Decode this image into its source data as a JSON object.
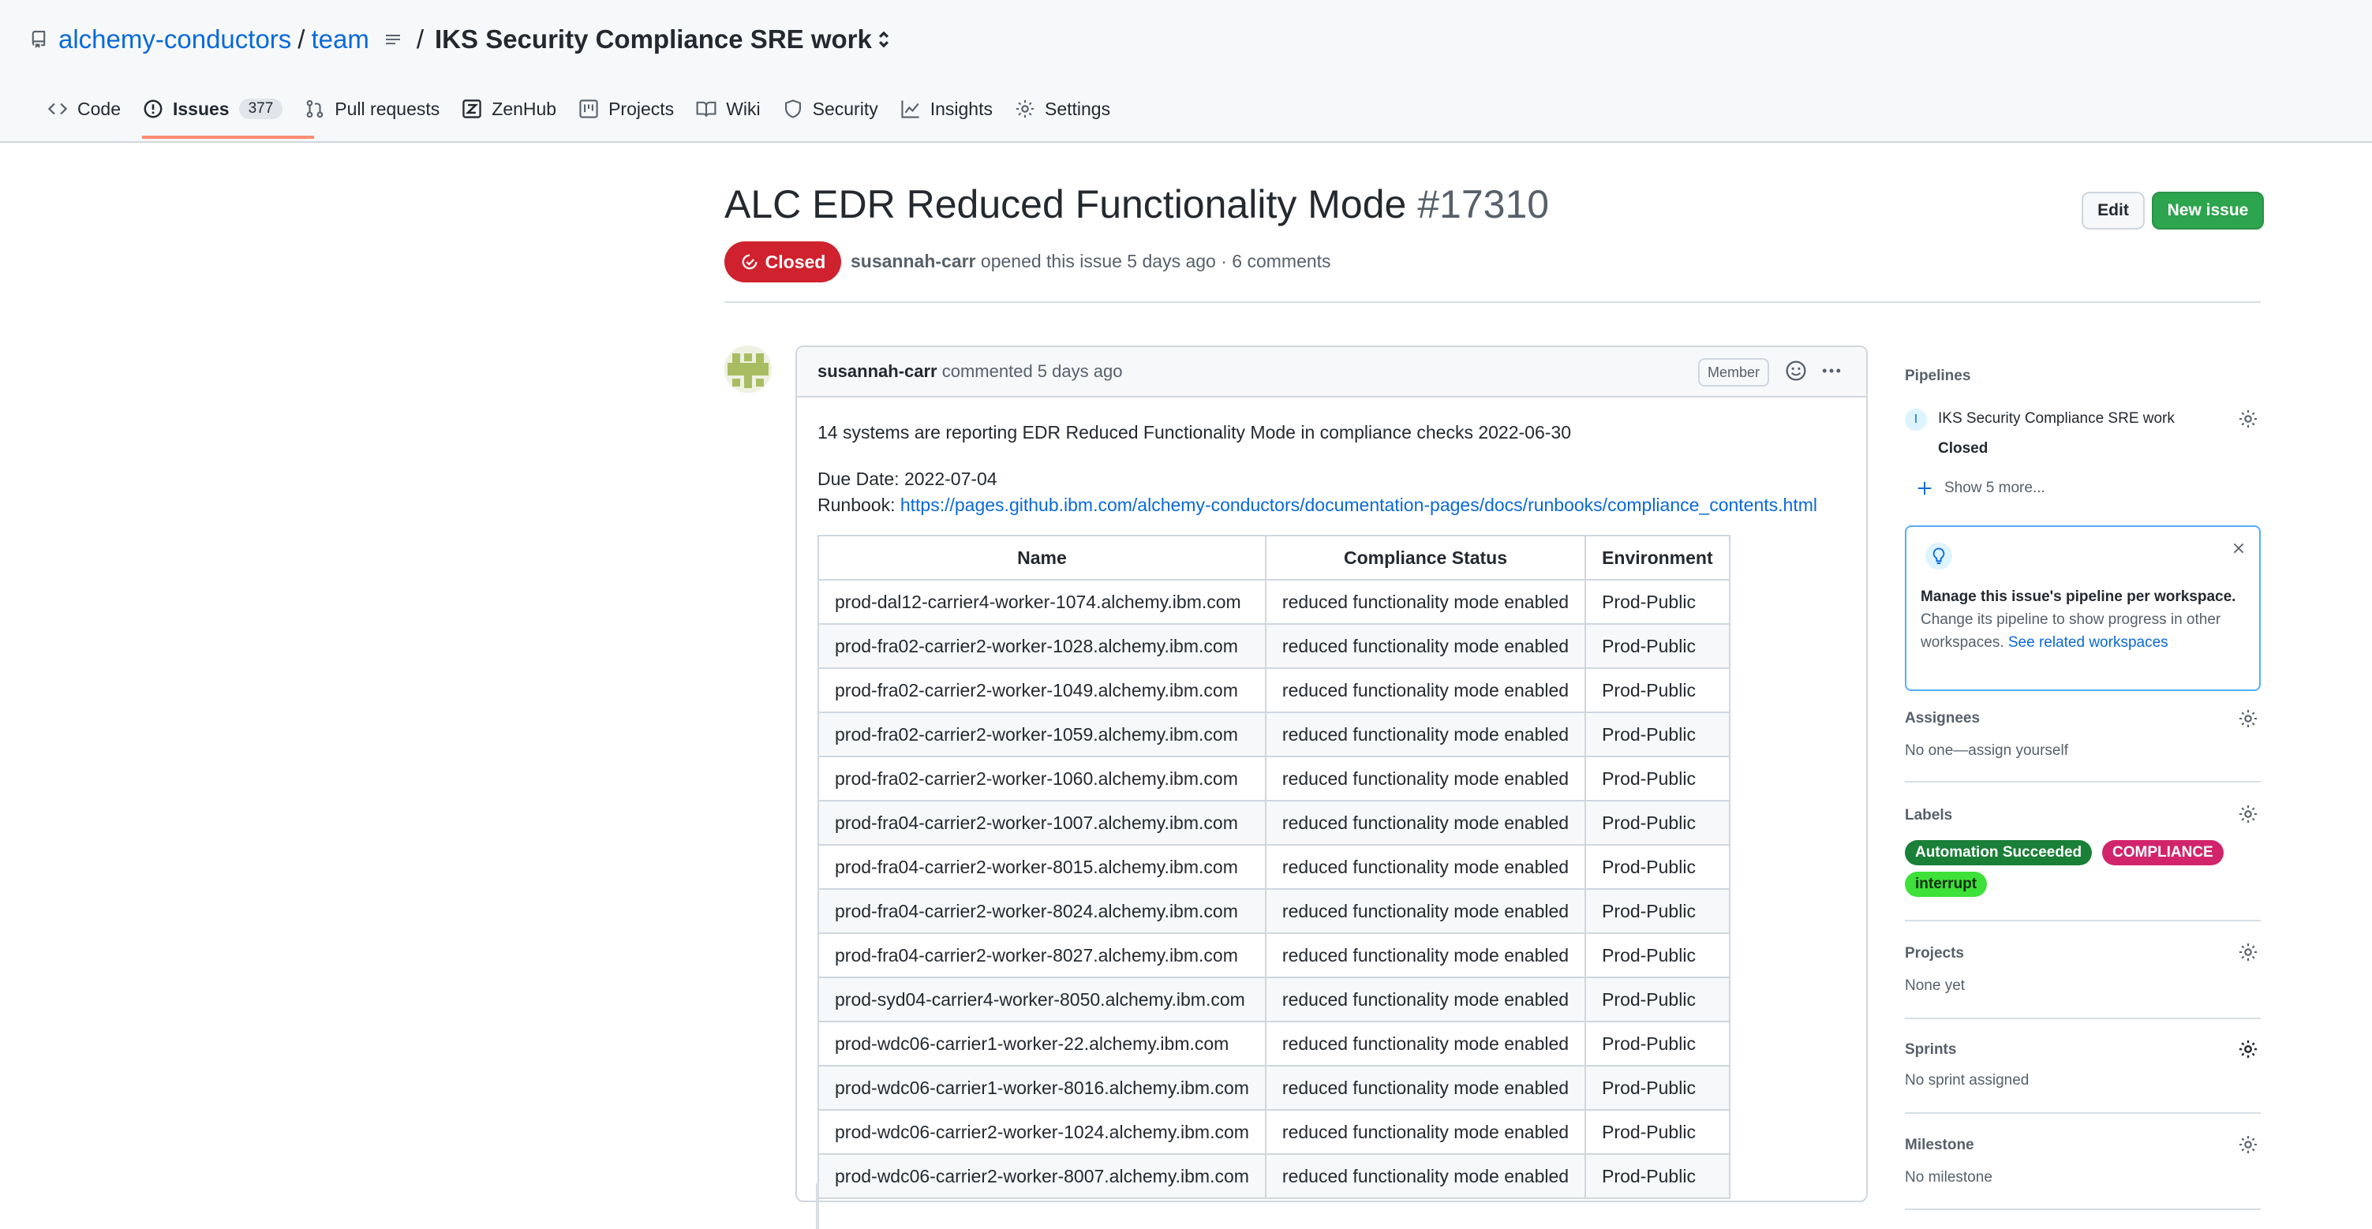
{
  "repo": {
    "owner": "alchemy-conductors",
    "name": "team",
    "workspace": "IKS Security Compliance SRE work"
  },
  "tabs": [
    {
      "label": "Code",
      "icon": "code-icon"
    },
    {
      "label": "Issues",
      "icon": "issue-opened-icon",
      "count": "377",
      "selected": true
    },
    {
      "label": "Pull requests",
      "icon": "git-pull-request-icon"
    },
    {
      "label": "ZenHub",
      "icon": "zenhub-icon"
    },
    {
      "label": "Projects",
      "icon": "project-icon"
    },
    {
      "label": "Wiki",
      "icon": "book-icon"
    },
    {
      "label": "Security",
      "icon": "shield-icon"
    },
    {
      "label": "Insights",
      "icon": "graph-icon"
    },
    {
      "label": "Settings",
      "icon": "gear-icon"
    }
  ],
  "issue": {
    "title": "ALC EDR Reduced Functionality Mode",
    "number": "#17310",
    "state": "Closed",
    "author": "susannah-carr",
    "meta": "opened this issue 5 days ago · 6 comments",
    "edit_label": "Edit",
    "new_label": "New issue"
  },
  "comment": {
    "author": "susannah-carr",
    "action": "commented 5 days ago",
    "badge": "Member",
    "line1": "14 systems are reporting EDR Reduced Functionality Mode in compliance checks 2022-06-30",
    "due": "Due Date: 2022-07-04",
    "runbook_label": "Runbook:",
    "runbook_url": "https://pages.github.ibm.com/alchemy-conductors/documentation-pages/docs/runbooks/compliance_contents.html",
    "table": {
      "headers": [
        "Name",
        "Compliance Status",
        "Environment"
      ],
      "rows": [
        [
          "prod-dal12-carrier4-worker-1074.alchemy.ibm.com",
          "reduced functionality mode enabled",
          "Prod-Public"
        ],
        [
          "prod-fra02-carrier2-worker-1028.alchemy.ibm.com",
          "reduced functionality mode enabled",
          "Prod-Public"
        ],
        [
          "prod-fra02-carrier2-worker-1049.alchemy.ibm.com",
          "reduced functionality mode enabled",
          "Prod-Public"
        ],
        [
          "prod-fra02-carrier2-worker-1059.alchemy.ibm.com",
          "reduced functionality mode enabled",
          "Prod-Public"
        ],
        [
          "prod-fra02-carrier2-worker-1060.alchemy.ibm.com",
          "reduced functionality mode enabled",
          "Prod-Public"
        ],
        [
          "prod-fra04-carrier2-worker-1007.alchemy.ibm.com",
          "reduced functionality mode enabled",
          "Prod-Public"
        ],
        [
          "prod-fra04-carrier2-worker-8015.alchemy.ibm.com",
          "reduced functionality mode enabled",
          "Prod-Public"
        ],
        [
          "prod-fra04-carrier2-worker-8024.alchemy.ibm.com",
          "reduced functionality mode enabled",
          "Prod-Public"
        ],
        [
          "prod-fra04-carrier2-worker-8027.alchemy.ibm.com",
          "reduced functionality mode enabled",
          "Prod-Public"
        ],
        [
          "prod-syd04-carrier4-worker-8050.alchemy.ibm.com",
          "reduced functionality mode enabled",
          "Prod-Public"
        ],
        [
          "prod-wdc06-carrier1-worker-22.alchemy.ibm.com",
          "reduced functionality mode enabled",
          "Prod-Public"
        ],
        [
          "prod-wdc06-carrier1-worker-8016.alchemy.ibm.com",
          "reduced functionality mode enabled",
          "Prod-Public"
        ],
        [
          "prod-wdc06-carrier2-worker-1024.alchemy.ibm.com",
          "reduced functionality mode enabled",
          "Prod-Public"
        ],
        [
          "prod-wdc06-carrier2-worker-8007.alchemy.ibm.com",
          "reduced functionality mode enabled",
          "Prod-Public"
        ]
      ]
    }
  },
  "sidebar": {
    "pipelines": {
      "heading": "Pipelines",
      "badge": "I",
      "workspace": "IKS Security Compliance SRE work",
      "pipeline": "Closed",
      "show_more": "Show 5 more..."
    },
    "info": {
      "bold": "Manage this issue's pipeline per workspace.",
      "text": " Change its pipeline to show progress in other workspaces. ",
      "link": "See related workspaces"
    },
    "assignees": {
      "heading": "Assignees",
      "value": "No one—assign yourself"
    },
    "labels": {
      "heading": "Labels",
      "items": [
        {
          "name": "Automation Succeeded",
          "color": "#1a7f37",
          "text": "#ffffff"
        },
        {
          "name": "COMPLIANCE",
          "color": "#d1246b",
          "text": "#ffffff"
        },
        {
          "name": "interrupt",
          "color": "#3ee03a",
          "text": "#0b2e0a"
        }
      ]
    },
    "projects": {
      "heading": "Projects",
      "value": "None yet"
    },
    "sprints": {
      "heading": "Sprints",
      "value": "No sprint assigned"
    },
    "milestone": {
      "heading": "Milestone",
      "value": "No milestone"
    }
  }
}
